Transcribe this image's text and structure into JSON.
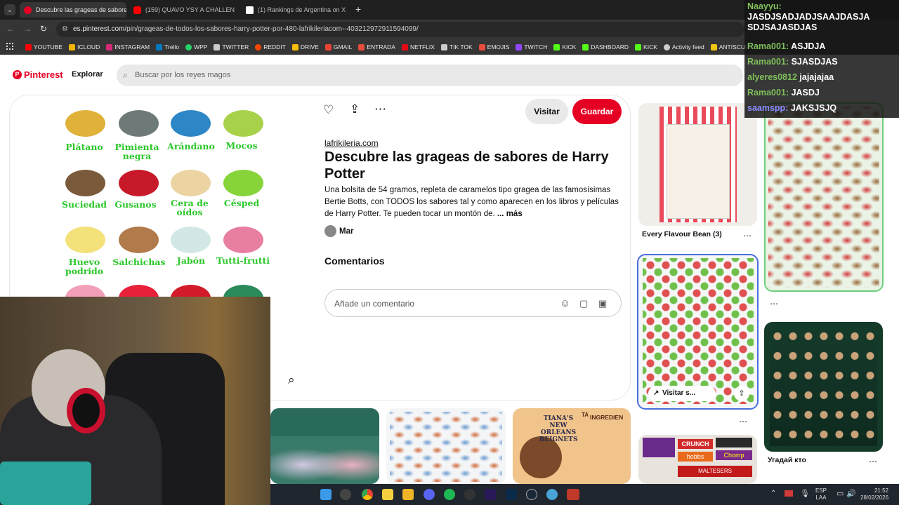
{
  "browser": {
    "tabs": [
      {
        "label": "Descubre las grageas de sabore",
        "active": true,
        "icon": "pinterest-icon",
        "color": "#e60023"
      },
      {
        "label": "(159) QUAVO YSY A CHALLENG",
        "active": false,
        "icon": "youtube-icon",
        "color": "#ff0000"
      },
      {
        "label": "(1) Rankings de Argentina on X",
        "active": false,
        "icon": "x-icon",
        "color": "#ffffff"
      }
    ],
    "new_tab": "+",
    "url_host": "es.pinterest.com",
    "url_path": "/pin/grageas-de-todos-los-sabores-harry-potter-por-480-lafrikileriacom--403212972911594099/",
    "bookmarks": [
      {
        "label": "YOUTUBE",
        "color": "#ff0000"
      },
      {
        "label": "ICLOUD",
        "color": "#f4b400"
      },
      {
        "label": "INSTAGRAM",
        "color": "#d62976"
      },
      {
        "label": "Trello",
        "color": "#0079bf"
      },
      {
        "label": "WPP",
        "color": "#25d366"
      },
      {
        "label": "TWITTER",
        "color": "#cccccc"
      },
      {
        "label": "REDDIT",
        "color": "#ff4500"
      },
      {
        "label": "DRIVE",
        "color": "#fbbc04"
      },
      {
        "label": "GMAIL",
        "color": "#ea4335"
      },
      {
        "label": "ENTRADA",
        "color": "#e74c3c"
      },
      {
        "label": "NETFLIX",
        "color": "#e50914"
      },
      {
        "label": "TIK TOK",
        "color": "#cccccc"
      },
      {
        "label": "EMOJIS",
        "color": "#e74c3c"
      },
      {
        "label": "TWITCH",
        "color": "#9146ff"
      },
      {
        "label": "KICK",
        "color": "#53fc18"
      },
      {
        "label": "DASHBOARD",
        "color": "#53fc18"
      },
      {
        "label": "KICK",
        "color": "#53fc18"
      },
      {
        "label": "Activity feed",
        "color": "#cccccc"
      },
      {
        "label": "ANTISCUF",
        "color": "#f1c40f"
      }
    ]
  },
  "pinterest": {
    "logo": "Pinterest",
    "explore": "Explorar",
    "search_placeholder": "Buscar por los reyes magos",
    "visit": "Visitar",
    "save": "Guardar",
    "source": "lafrikileria.com",
    "title": "Descubre las grageas de sabores de Harry Potter",
    "description": "Una bolsita de 54 gramos, repleta de caramelos tipo gragea de las famosísimas Bertie Botts, con TODOS los sabores tal y como aparecen en los libros y películas de Harry Potter. Te pueden tocar un montón de.",
    "more": "... más",
    "author": "Mar",
    "comments_title": "Comentarios",
    "comment_placeholder": "Añade un comentario",
    "beans": [
      {
        "label": "Plátano",
        "color": "#e0b23a"
      },
      {
        "label": "Pimienta negra",
        "color": "#6e7a78"
      },
      {
        "label": "Arándano",
        "color": "#2d86c6"
      },
      {
        "label": "Mocos",
        "color": "#a8d14a"
      },
      {
        "label": "Suciedad",
        "color": "#7a5a3a"
      },
      {
        "label": "Gusanos",
        "color": "#c8192a"
      },
      {
        "label": "Cera de oídos",
        "color": "#ecd3a2"
      },
      {
        "label": "Césped",
        "color": "#86d43a"
      },
      {
        "label": "Huevo podrido",
        "color": "#f3e27a"
      },
      {
        "label": "Salchichas",
        "color": "#b07a4a"
      },
      {
        "label": "Jabón",
        "color": "#d3e8e6"
      },
      {
        "label": "Tutti-frutti",
        "color": "#e87ea0"
      }
    ],
    "side_captions": {
      "card1": "Every Flavour Bean (3)",
      "visit_small": "Visitar s...",
      "card4": "Угадай кто"
    },
    "thumb_labels": {
      "tiana_small": "TA",
      "tiana_top": "INGREDIEN",
      "tiana_main": "TIANA'S NEW ORLEANS BEIGNETS",
      "candy_crunch": "CRUNCH",
      "candy_hobbs": "hobbs",
      "candy_chomp": "Chomp",
      "candy_maltesers": "MALTESERS"
    }
  },
  "chat": [
    {
      "user": "Naayyu:",
      "msg": "JASDJSADJADJSAAJDASJA SDJSAJASDJAS"
    },
    {
      "user": "Rama001:",
      "msg": "ASJDJA"
    },
    {
      "user": "Rama001:",
      "msg": "SJASDJAS"
    },
    {
      "user": "alyeres0812",
      "msg": "jajajajaa"
    },
    {
      "user": "Rama001:",
      "msg": "JASDJ"
    },
    {
      "user": "saamspp:",
      "msg": "JAKSJSJQ"
    }
  ],
  "taskbar": {
    "lang": "ESP",
    "lang2": "LAA",
    "time": "21:52",
    "date": "28/02/2026"
  }
}
